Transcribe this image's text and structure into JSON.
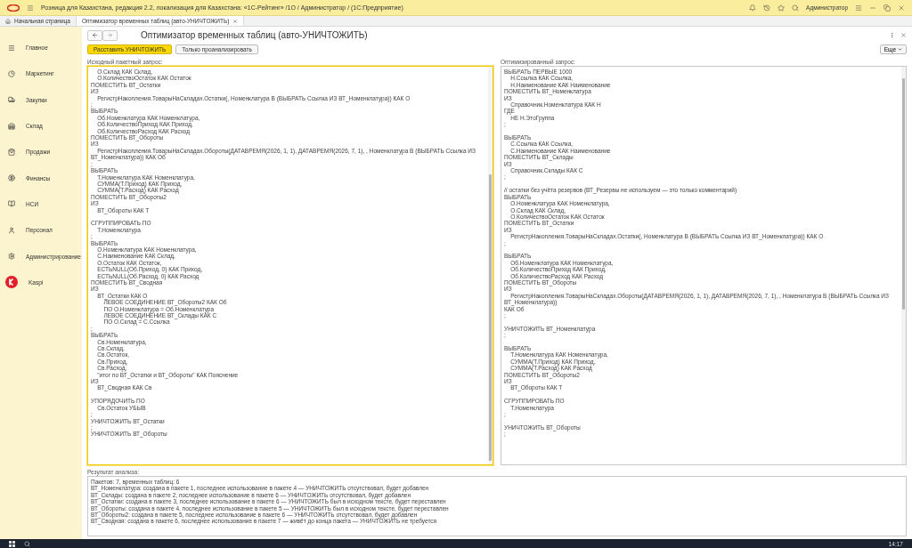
{
  "window": {
    "title": "Розница для Казахстана, редакция 2.2, локализация для Казахстана: «1С-Рейтинг» /1О / Администратор /  (1С:Предприятие)",
    "user": "Администратор"
  },
  "tabs": [
    {
      "label": "Начальная страница",
      "kind": "home",
      "selected": false
    },
    {
      "label": "Оптимизатор временных таблиц (авто-УНИЧТОЖИТЬ)",
      "kind": "document",
      "selected": true
    }
  ],
  "sidebar": {
    "items": [
      {
        "label": "Главное",
        "kind": "menu"
      },
      {
        "label": "Маркетинг",
        "kind": "marketing"
      },
      {
        "label": "Закупки",
        "kind": "purchases"
      },
      {
        "label": "Склад",
        "kind": "warehouse"
      },
      {
        "label": "Продажи",
        "kind": "sales"
      },
      {
        "label": "Финансы",
        "kind": "finance"
      },
      {
        "label": "НСИ",
        "kind": "reference"
      },
      {
        "label": "Персонал",
        "kind": "staff"
      },
      {
        "label": "Администрирование",
        "kind": "admin"
      },
      {
        "label": "Kaspi",
        "kind": "kaspi"
      }
    ]
  },
  "form": {
    "title": "Оптимизатор временных таблиц (авто-УНИЧТОЖИТЬ)",
    "buttons": [
      {
        "label": "Расставить УНИЧТОЖИТЬ",
        "kind": "primary"
      },
      {
        "label": "Только проанализировать",
        "kind": "default"
      }
    ],
    "more_button": "Еще",
    "source": {
      "label": "Исходный пакетный запрос:",
      "focused": true,
      "lines": [
        {
          "kind": "code",
          "text": "    О.Склад КАК Склад,"
        },
        {
          "kind": "code",
          "text": "    О.КоличествоОстаток КАК Остаток"
        },
        {
          "kind": "code",
          "text": "ПОМЕСТИТЬ ВТ_Остатки"
        },
        {
          "kind": "code",
          "text": "ИЗ"
        },
        {
          "kind": "code",
          "text": "    РегистрНакопления.ТоварыНаСкладах.Остатки(, Номенклатура В (ВЫБРАТЬ Ссылка ИЗ ВТ_Номенклатура)) КАК О"
        },
        {
          "kind": "code",
          "text": ";"
        },
        {
          "kind": "code",
          "text": "ВЫБРАТЬ"
        },
        {
          "kind": "code",
          "text": "    Об.Номенклатура КАК Номенклатура,"
        },
        {
          "kind": "code",
          "text": "    Об.КоличествоПриход КАК Приход,"
        },
        {
          "kind": "code",
          "text": "    Об.КоличествоРасход КАК Расход"
        },
        {
          "kind": "code",
          "text": "ПОМЕСТИТЬ ВТ_Обороты"
        },
        {
          "kind": "code",
          "text": "ИЗ"
        },
        {
          "kind": "code",
          "text": "    РегистрНакопления.ТоварыНаСкладах.Обороты(ДАТАВРЕМЯ(2026, 1, 1), ДАТАВРЕМЯ(2026, 7, 1), , Номенклатура В (ВЫБРАТЬ Ссылка ИЗ ВТ_Номенклатура)) КАК Об"
        },
        {
          "kind": "code",
          "text": ";"
        },
        {
          "kind": "code",
          "text": "ВЫБРАТЬ"
        },
        {
          "kind": "code",
          "text": "    Т.Номенклатура КАК Номенклатура,"
        },
        {
          "kind": "code",
          "text": "    СУММА(Т.Приход) КАК Приход,"
        },
        {
          "kind": "code",
          "text": "    СУММА(Т.Расход) КАК Расход"
        },
        {
          "kind": "code",
          "text": "ПОМЕСТИТЬ ВТ_Обороты2"
        },
        {
          "kind": "code",
          "text": "ИЗ"
        },
        {
          "kind": "code",
          "text": "    ВТ_Обороты КАК Т"
        },
        {
          "kind": "blank"
        },
        {
          "kind": "code",
          "text": "СГРУППИРОВАТЬ ПО"
        },
        {
          "kind": "code",
          "text": "    Т.Номенклатура"
        },
        {
          "kind": "code",
          "text": ";"
        },
        {
          "kind": "code",
          "text": "ВЫБРАТЬ"
        },
        {
          "kind": "code",
          "text": "    О.Номенклатура КАК Номенклатура,"
        },
        {
          "kind": "code",
          "text": "    С.Наименование КАК Склад,"
        },
        {
          "kind": "code",
          "text": "    О.Остаток КАК Остаток,"
        },
        {
          "kind": "code",
          "text": "    ЕСТЬNULL(Об.Приход, 0) КАК Приход,"
        },
        {
          "kind": "code",
          "text": "    ЕСТЬNULL(Об.Расход, 0) КАК Расход"
        },
        {
          "kind": "code",
          "text": "ПОМЕСТИТЬ ВТ_Сводная"
        },
        {
          "kind": "code",
          "text": "ИЗ"
        },
        {
          "kind": "code",
          "text": "    ВТ_Остатки КАК О"
        },
        {
          "kind": "code",
          "text": "        ЛЕВОЕ СОЕДИНЕНИЕ ВТ_Обороты2 КАК Об"
        },
        {
          "kind": "code",
          "text": "        ПО О.Номенклатура = Об.Номенклатура"
        },
        {
          "kind": "code",
          "text": "        ЛЕВОЕ СОЕДИНЕНИЕ ВТ_Склады КАК С"
        },
        {
          "kind": "code",
          "text": "        ПО О.Склад = С.Ссылка"
        },
        {
          "kind": "code",
          "text": ";"
        },
        {
          "kind": "code",
          "text": "ВЫБРАТЬ"
        },
        {
          "kind": "code",
          "text": "    Св.Номенклатура,"
        },
        {
          "kind": "code",
          "text": "    Св.Склад,"
        },
        {
          "kind": "code",
          "text": "    Св.Остаток,"
        },
        {
          "kind": "code",
          "text": "    Св.Приход,"
        },
        {
          "kind": "code",
          "text": "    Св.Расход,"
        },
        {
          "kind": "code",
          "text": "    \"итог по ВТ_Остатки и ВТ_Обороты\" КАК Пояснение"
        },
        {
          "kind": "code",
          "text": "ИЗ"
        },
        {
          "kind": "code",
          "text": "    ВТ_Сводная КАК Св"
        },
        {
          "kind": "blank"
        },
        {
          "kind": "code",
          "text": "УПОРЯДОЧИТЬ ПО"
        },
        {
          "kind": "code",
          "text": "    Св.Остаток УБЫВ"
        },
        {
          "kind": "code",
          "text": ";"
        },
        {
          "kind": "code",
          "text": "УНИЧТОЖИТЬ ВТ_Остатки"
        },
        {
          "kind": "code",
          "text": ";"
        },
        {
          "kind": "code",
          "text": "УНИЧТОЖИТЬ ВТ_Обороты"
        }
      ]
    },
    "optimized": {
      "label": "Оптимизированный запрос:",
      "focused": false,
      "lines": [
        {
          "kind": "code",
          "text": "ВЫБРАТЬ ПЕРВЫЕ 1000"
        },
        {
          "kind": "code",
          "text": "    Н.Ссылка КАК Ссылка,"
        },
        {
          "kind": "code",
          "text": "    Н.Наименование КАК Наименование"
        },
        {
          "kind": "code",
          "text": "ПОМЕСТИТЬ ВТ_Номенклатура"
        },
        {
          "kind": "code",
          "text": "ИЗ"
        },
        {
          "kind": "code",
          "text": "    Справочник.Номенклатура КАК Н"
        },
        {
          "kind": "code",
          "text": "ГДЕ"
        },
        {
          "kind": "code",
          "text": "    НЕ Н.ЭтоГруппа"
        },
        {
          "kind": "code",
          "text": ";"
        },
        {
          "kind": "blank"
        },
        {
          "kind": "code",
          "text": "ВЫБРАТЬ"
        },
        {
          "kind": "code",
          "text": "    С.Ссылка КАК Ссылка,"
        },
        {
          "kind": "code",
          "text": "    С.Наименование КАК Наименование"
        },
        {
          "kind": "code",
          "text": "ПОМЕСТИТЬ ВТ_Склады"
        },
        {
          "kind": "code",
          "text": "ИЗ"
        },
        {
          "kind": "code",
          "text": "    Справочник.Склады КАК С"
        },
        {
          "kind": "code",
          "text": ";"
        },
        {
          "kind": "blank"
        },
        {
          "kind": "code",
          "text": "// остатки без учёта резервов (ВТ_Резервы не используем — это только комментарий)"
        },
        {
          "kind": "code",
          "text": "ВЫБРАТЬ"
        },
        {
          "kind": "code",
          "text": "    О.Номенклатура КАК Номенклатура,"
        },
        {
          "kind": "code",
          "text": "    О.Склад КАК Склад,"
        },
        {
          "kind": "code",
          "text": "    О.КоличествоОстаток КАК Остаток"
        },
        {
          "kind": "code",
          "text": "ПОМЕСТИТЬ ВТ_Остатки"
        },
        {
          "kind": "code",
          "text": "ИЗ"
        },
        {
          "kind": "code",
          "text": "    РегистрНакопления.ТоварыНаСкладах.Остатки(, Номенклатура В (ВЫБРАТЬ Ссылка ИЗ ВТ_Номенклатура)) КАК О"
        },
        {
          "kind": "code",
          "text": ";"
        },
        {
          "kind": "blank"
        },
        {
          "kind": "code",
          "text": "ВЫБРАТЬ"
        },
        {
          "kind": "code",
          "text": "    Об.Номенклатура КАК Номенклатура,"
        },
        {
          "kind": "code",
          "text": "    Об.КоличествоПриход КАК Приход,"
        },
        {
          "kind": "code",
          "text": "    Об.КоличествоРасход КАК Расход"
        },
        {
          "kind": "code",
          "text": "ПОМЕСТИТЬ ВТ_Обороты"
        },
        {
          "kind": "code",
          "text": "ИЗ"
        },
        {
          "kind": "code",
          "text": "    РегистрНакопления.ТоварыНаСкладах.Обороты(ДАТАВРЕМЯ(2026, 1, 1), ДАТАВРЕМЯ(2026, 7, 1), , Номенклатура В (ВЫБРАТЬ Ссылка ИЗ ВТ_Номенклатура))"
        },
        {
          "kind": "code",
          "text": "КАК Об"
        },
        {
          "kind": "code",
          "text": ";"
        },
        {
          "kind": "blank"
        },
        {
          "kind": "code",
          "text": "УНИЧТОЖИТЬ ВТ_Номенклатура"
        },
        {
          "kind": "code",
          "text": ";"
        },
        {
          "kind": "blank"
        },
        {
          "kind": "code",
          "text": "ВЫБРАТЬ"
        },
        {
          "kind": "code",
          "text": "    Т.Номенклатура КАК Номенклатура,"
        },
        {
          "kind": "code",
          "text": "    СУММА(Т.Приход) КАК Приход,"
        },
        {
          "kind": "code",
          "text": "    СУММА(Т.Расход) КАК Расход"
        },
        {
          "kind": "code",
          "text": "ПОМЕСТИТЬ ВТ_Обороты2"
        },
        {
          "kind": "code",
          "text": "ИЗ"
        },
        {
          "kind": "code",
          "text": "    ВТ_Обороты КАК Т"
        },
        {
          "kind": "blank"
        },
        {
          "kind": "code",
          "text": "СГРУППИРОВАТЬ ПО"
        },
        {
          "kind": "code",
          "text": "    Т.Номенклатура"
        },
        {
          "kind": "code",
          "text": ";"
        },
        {
          "kind": "blank"
        },
        {
          "kind": "code",
          "text": "УНИЧТОЖИТЬ ВТ_Обороты"
        },
        {
          "kind": "code",
          "text": ";"
        }
      ]
    },
    "result": {
      "label": "Результат анализа:",
      "lines": [
        "Пакетов: 7, временных таблиц: 6",
        "ВТ_Номенклатура: создана в пакете 1, последнее использование в пакете 4 — УНИЧТОЖИТЬ отсутствовал, будет добавлен",
        "ВТ_Склады: создана в пакете 2, последнее использование в пакете 6 — УНИЧТОЖИТЬ отсутствовал, будет добавлен",
        "ВТ_Остатки: создана в пакете 3, последнее использование в пакете 6 — УНИЧТОЖИТЬ был в исходном тексте, будет переставлен",
        "ВТ_Обороты: создана в пакете 4, последнее использование в пакете 5 — УНИЧТОЖИТЬ был в исходном тексте, будет переставлен",
        "ВТ_Обороты2: создана в пакете 5, последнее использование в пакете 6 — УНИЧТОЖИТЬ отсутствовал, будет добавлен",
        "ВТ_Сводная: создана в пакете 6, последнее использование в пакете 7 — живёт до конца пакета — УНИЧТОЖИТЬ не требуется"
      ]
    }
  },
  "taskbar": {
    "clock": "14:17"
  }
}
